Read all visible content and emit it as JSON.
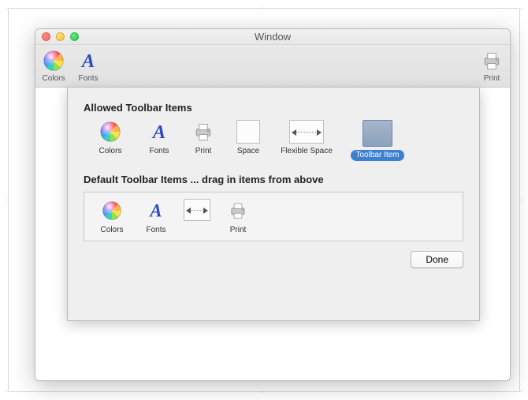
{
  "window": {
    "title": "Window"
  },
  "toolbar": {
    "colors": "Colors",
    "fonts": "Fonts",
    "print": "Print"
  },
  "sheet": {
    "allowed_title": "Allowed Toolbar Items",
    "default_title": "Default Toolbar Items ... drag in items from above",
    "done": "Done",
    "items": {
      "colors": "Colors",
      "fonts": "Fonts",
      "print": "Print",
      "space": "Space",
      "flexible_space": "Flexible Space",
      "toolbar_item": "Toolbar Item"
    },
    "defaults": {
      "colors": "Colors",
      "fonts": "Fonts",
      "print": "Print"
    }
  }
}
